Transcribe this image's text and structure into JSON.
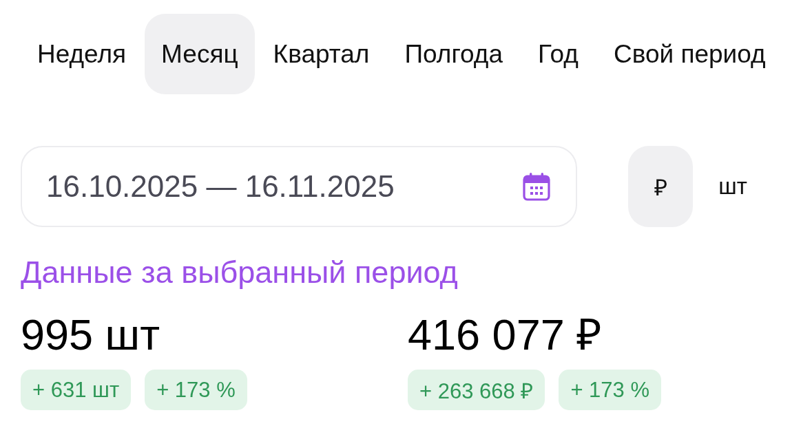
{
  "period_tabs": [
    {
      "label": "Неделя",
      "selected": false
    },
    {
      "label": "Месяц",
      "selected": true
    },
    {
      "label": "Квартал",
      "selected": false
    },
    {
      "label": "Полгода",
      "selected": false
    },
    {
      "label": "Год",
      "selected": false
    },
    {
      "label": "Свой период",
      "selected": false
    }
  ],
  "date_range": {
    "value": "16.10.2025 — 16.11.2025"
  },
  "unit_toggle": [
    {
      "label": "₽",
      "selected": true
    },
    {
      "label": "шт",
      "selected": false
    }
  ],
  "section_title": "Данные за выбранный период",
  "metrics": [
    {
      "value": "995 шт",
      "changes": [
        "+ 631 шт",
        "+ 173 %"
      ]
    },
    {
      "value": "416 077 ₽",
      "changes": [
        "+ 263 668 ₽",
        "+ 173 %"
      ]
    }
  ]
}
